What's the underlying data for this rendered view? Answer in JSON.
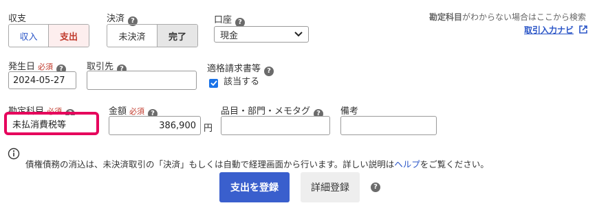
{
  "income_expense": {
    "label": "収支",
    "options": [
      "収入",
      "支出"
    ],
    "selected": "支出"
  },
  "settlement": {
    "label": "決済",
    "options": [
      "未決済",
      "完了"
    ],
    "selected": "完了"
  },
  "account": {
    "label": "口座",
    "value": "現金"
  },
  "help_hint": {
    "bold": "勘定科目",
    "text": "がわからない場合はここから検索",
    "link": "取引入力ナビ"
  },
  "date": {
    "label": "発生日",
    "required": "必須",
    "value": "2024-05-27"
  },
  "partner": {
    "label": "取引先",
    "value": ""
  },
  "invoice": {
    "label": "適格請求書等",
    "checkbox_label": "該当する",
    "checked": true
  },
  "account_item": {
    "label": "勘定科目",
    "required": "必須",
    "value": "未払消費税等"
  },
  "amount": {
    "label": "金額",
    "required": "必須",
    "value": "386,900",
    "unit": "円"
  },
  "item_tags": {
    "label": "品目・部門・メモタグ",
    "value": ""
  },
  "memo": {
    "label": "備考",
    "value": ""
  },
  "info": {
    "before": "債権債務の消込は、未決済取引の「決済」もしくは自動で経理画面から行います。詳しい説明は",
    "link": "ヘルプ",
    "after": "をご覧ください。"
  },
  "actions": {
    "submit": "支出を登録",
    "detail": "詳細登録"
  },
  "colors": {
    "primary": "#3a5fcd",
    "expense_red": "#c0392b",
    "highlight": "#e6005c"
  }
}
